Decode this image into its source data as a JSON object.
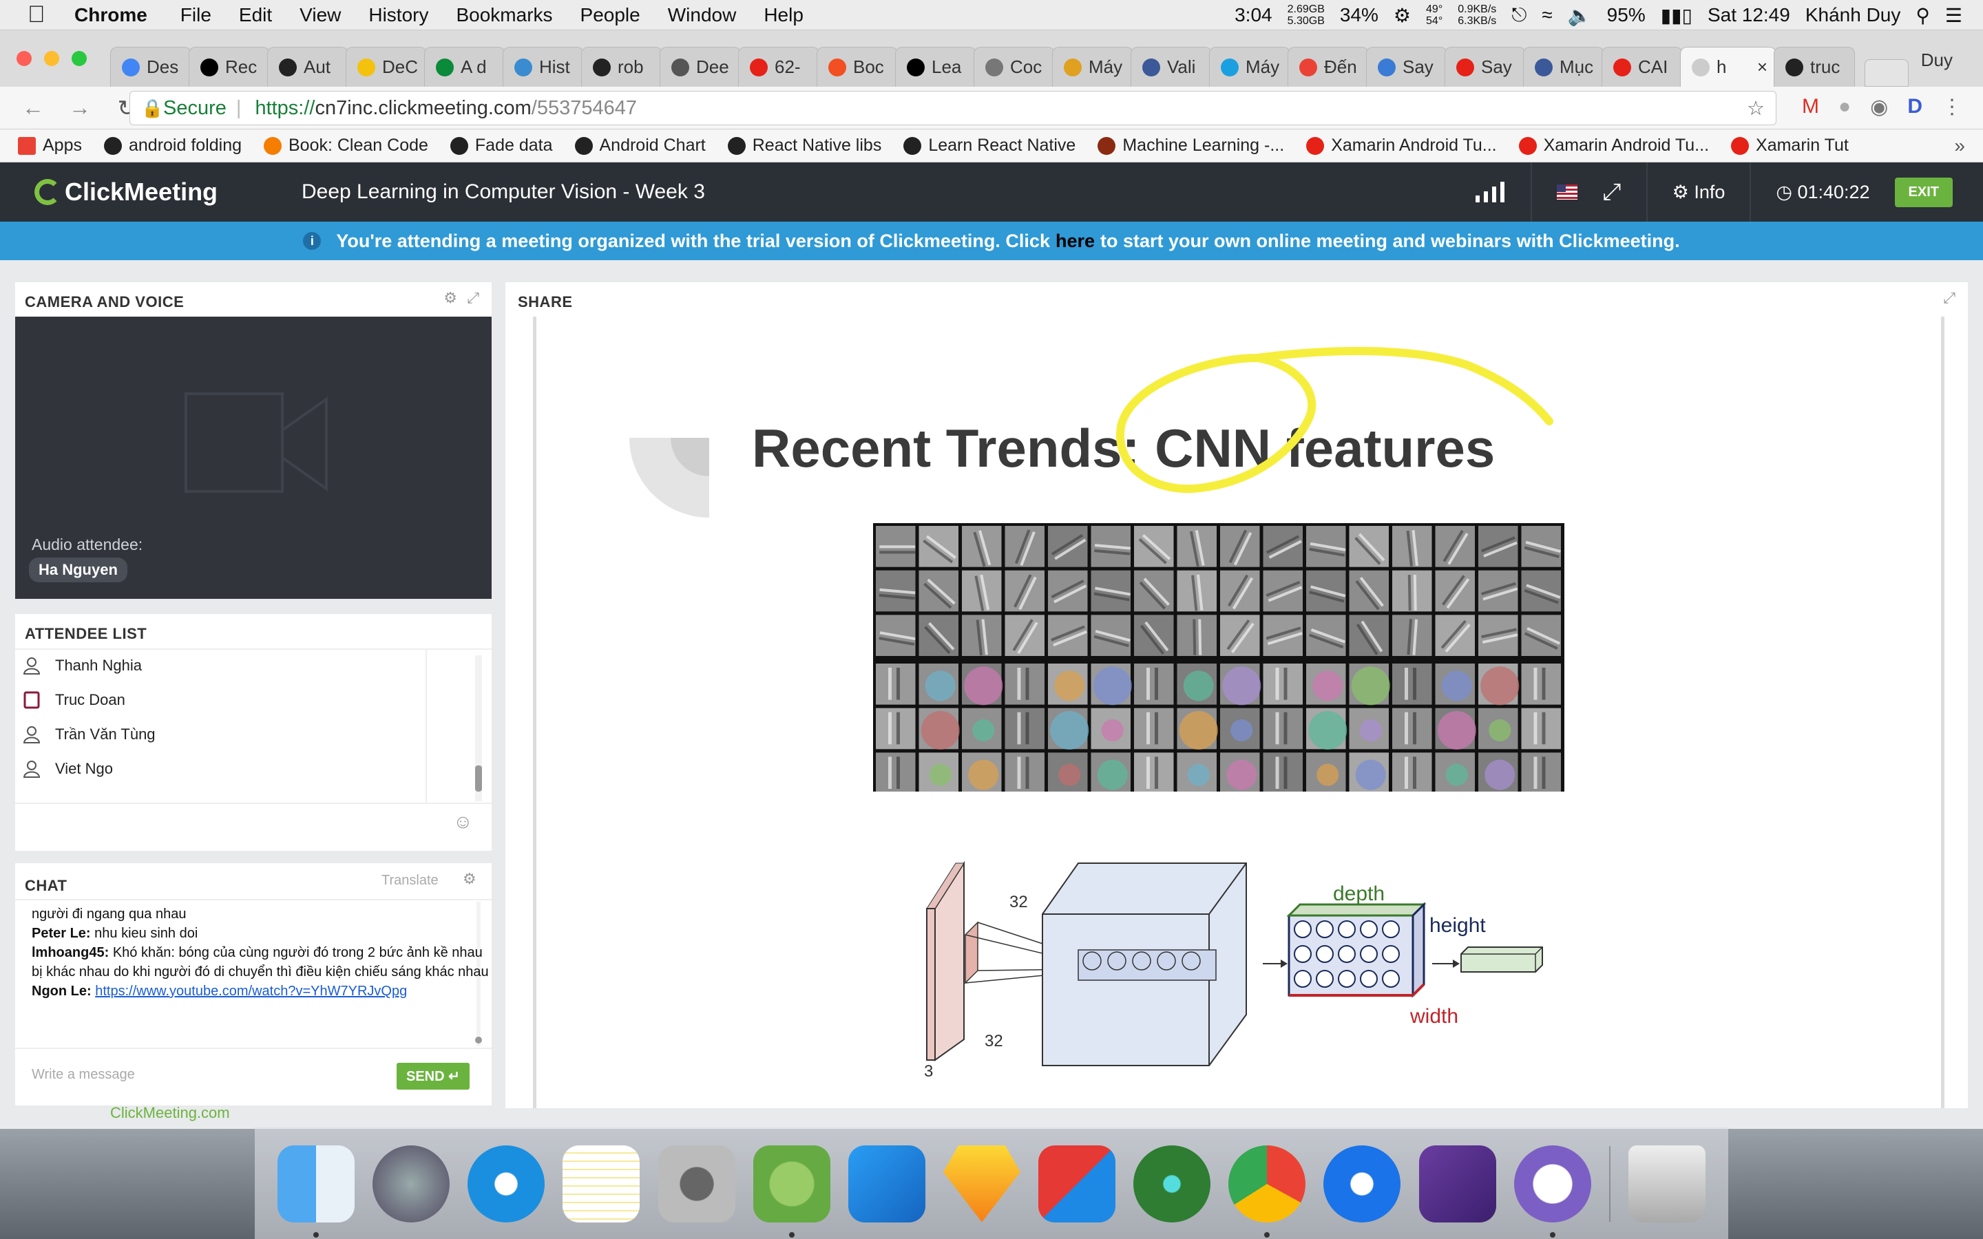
{
  "menubar": {
    "app": "Chrome",
    "items": [
      "File",
      "Edit",
      "View",
      "History",
      "Bookmarks",
      "People",
      "Window",
      "Help"
    ],
    "battery_time": "3:04",
    "mem_used": "2.69GB",
    "mem_free": "5.30GB",
    "cpu": "34%",
    "temp_top": "49°",
    "temp_bottom": "54°",
    "net_up": "0.9KB/s",
    "net_down": "6.3KB/s",
    "battery_pct": "95%",
    "clock": "Sat 12:49",
    "user": "Khánh Duy"
  },
  "tabs": [
    {
      "label": "Des",
      "color": "#4285f4"
    },
    {
      "label": "Rec",
      "color": "#000000"
    },
    {
      "label": "Aut",
      "color": "#222222"
    },
    {
      "label": "DeC",
      "color": "#f4c20d"
    },
    {
      "label": "A d",
      "color": "#0a8a3a"
    },
    {
      "label": "Hist",
      "color": "#3b8bd0"
    },
    {
      "label": "rob",
      "color": "#222222"
    },
    {
      "label": "Dee",
      "color": "#555555"
    },
    {
      "label": "62-",
      "color": "#e62117"
    },
    {
      "label": "Boc",
      "color": "#f25022"
    },
    {
      "label": "Lea",
      "color": "#000000"
    },
    {
      "label": "Coc",
      "color": "#777777"
    },
    {
      "label": "Máy",
      "color": "#e0a020"
    },
    {
      "label": "Vali",
      "color": "#3b5998"
    },
    {
      "label": "Máy",
      "color": "#1aa0e0"
    },
    {
      "label": "Đến",
      "color": "#ea4335"
    },
    {
      "label": "Say",
      "color": "#3a7bd5"
    },
    {
      "label": "Say",
      "color": "#e62117"
    },
    {
      "label": "Mục",
      "color": "#3b5998"
    },
    {
      "label": "CAI",
      "color": "#e62117"
    },
    {
      "label": "h",
      "color": "#cccccc",
      "active": true
    },
    {
      "label": "truc",
      "color": "#222222"
    }
  ],
  "profile_name": "Duy",
  "address": {
    "secure_label": "Secure",
    "scheme": "https://",
    "host": "cn7inc.clickmeeting.com",
    "path": "/553754647"
  },
  "bookmarks": [
    {
      "label": "Apps",
      "color": "#e94235"
    },
    {
      "label": "android folding",
      "color": "#222222"
    },
    {
      "label": "Book: Clean Code",
      "color": "#f57d00"
    },
    {
      "label": "Fade data",
      "color": "#222222"
    },
    {
      "label": "Android Chart",
      "color": "#222222"
    },
    {
      "label": "React Native libs",
      "color": "#222222"
    },
    {
      "label": "Learn React Native",
      "color": "#222222"
    },
    {
      "label": "Machine Learning -...",
      "color": "#8a2a10"
    },
    {
      "label": "Xamarin Android Tu...",
      "color": "#e62117"
    },
    {
      "label": "Xamarin Android Tu...",
      "color": "#e62117"
    },
    {
      "label": "Xamarin Tut",
      "color": "#e62117"
    }
  ],
  "meeting": {
    "logo": "ClickMeeting",
    "title": "Deep Learning in Computer Vision - Week 3",
    "info_label": "Info",
    "timer": "01:40:22",
    "exit_label": "EXIT"
  },
  "trial": {
    "before": "You're attending a meeting organized with the trial version of Clickmeeting. Click",
    "link": "here",
    "after": "to start your own online meeting and webinars with Clickmeeting."
  },
  "camera": {
    "title": "CAMERA AND VOICE",
    "audio_label": "Audio attendee:",
    "attendee": "Ha Nguyen"
  },
  "attendees": {
    "title": "ATTENDEE LIST",
    "items": [
      "Thanh Nghia",
      "Truc Doan",
      "Trần Văn Tùng",
      "Viet Ngo"
    ]
  },
  "chat": {
    "title": "CHAT",
    "translate_label": "Translate",
    "messages": [
      {
        "author": "",
        "text": "người đi ngang qua nhau"
      },
      {
        "author": "Peter Le:",
        "text": "nhu kieu sinh doi"
      },
      {
        "author": "lmhoang45:",
        "text": "Khó khăn: bóng của cùng người đó trong 2 bức ảnh kề nhau bị khác nhau do khi người đó di chuyển thì điều kiện chiếu sáng khác nhau"
      },
      {
        "author": "Ngon Le:",
        "link": "https://www.youtube.com/watch?v=YhW7YRJvQpg"
      }
    ],
    "placeholder": "Write a message",
    "send_label": "SEND",
    "powered_link": "ClickMeeting.com"
  },
  "share": {
    "title": "SHARE",
    "slide_title": "Recent Trends: CNN features",
    "diagram": {
      "label_32_top": "32",
      "label_32_bottom": "32",
      "label_3": "3",
      "depth": "depth",
      "height": "height",
      "width": "width"
    }
  },
  "colors": {
    "header": "#2b2f36",
    "trial_banner": "#2f9ad6",
    "accent_green": "#6bb33f",
    "annotation_yellow": "#f6ee3c"
  }
}
